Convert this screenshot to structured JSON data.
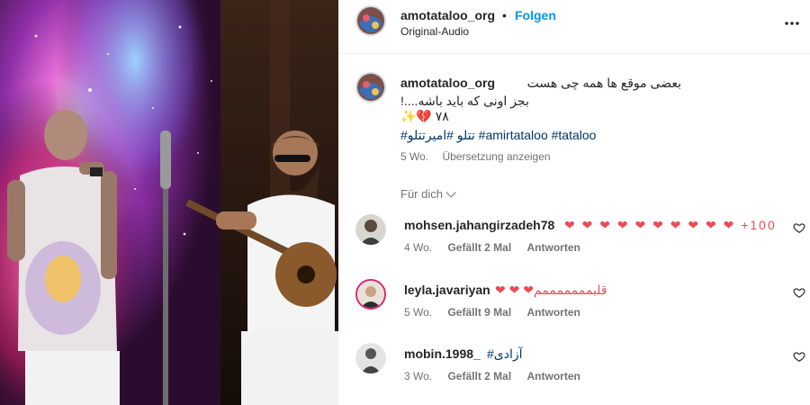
{
  "header": {
    "username": "amotataloo_org",
    "separator": "•",
    "follow_label": "Folgen",
    "audio_label": "Original-Audio",
    "more_icon": "more-horizontal-icon"
  },
  "caption": {
    "username": "amotataloo_org",
    "line1": "بعضی موقع ها همه چی هست",
    "line2": "بجز اونی که باید باشه....!۷۸ 💔✨",
    "hashtags": "#تتلو #امیرتتلو #amirtataloo #tataloo",
    "age": "5 Wo.",
    "translate_label": "Übersetzung anzeigen"
  },
  "filter": {
    "label": "Für dich"
  },
  "comments": [
    {
      "username": "mohsen.jahangirzadeh78",
      "text": "❤ ❤ ❤ ❤ ❤ ❤ ❤ ❤ ❤ ❤ +100",
      "age": "4 Wo.",
      "likes": "Gefällt 2 Mal",
      "reply": "Antworten"
    },
    {
      "username": "leyla.javariyan",
      "text": "❤ ❤ ❤قلبمممممممم",
      "age": "5 Wo.",
      "likes": "Gefällt 9 Mal",
      "reply": "Antworten"
    },
    {
      "username": "mobin.1998_",
      "text": "#آزادی",
      "age": "3 Wo.",
      "likes": "Gefällt 2 Mal",
      "reply": "Antworten"
    }
  ],
  "colors": {
    "link_blue": "#0095f6",
    "hashtag_blue": "#00376b",
    "heart_red": "#ed4956",
    "muted_gray": "#737373"
  }
}
